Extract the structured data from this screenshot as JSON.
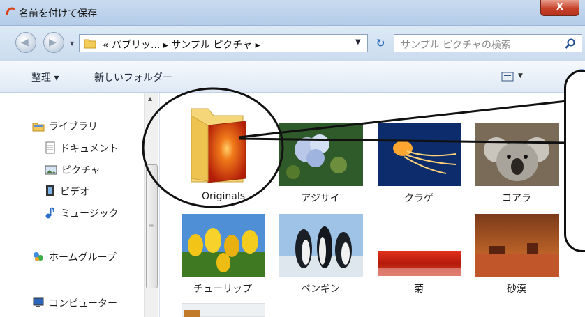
{
  "window": {
    "title": "名前を付けて保存",
    "close_label": "X"
  },
  "address_bar": {
    "path_text": "«  パブリッ...  ▸  サンプル ピクチャ  ▸",
    "search_placeholder": "サンプル ピクチャの検索"
  },
  "command_bar": {
    "organize": "整理 ▾",
    "new_folder": "新しいフォルダー"
  },
  "nav_pane": {
    "items": [
      {
        "label": "ライブラリ",
        "icon": "library-icon"
      },
      {
        "label": "ドキュメント",
        "icon": "documents-icon"
      },
      {
        "label": "ピクチャ",
        "icon": "pictures-icon"
      },
      {
        "label": "ビデオ",
        "icon": "video-icon"
      },
      {
        "label": "ミュージック",
        "icon": "music-icon"
      },
      {
        "label": "ホームグループ",
        "icon": "homegroup-icon"
      },
      {
        "label": "コンピューター",
        "icon": "computer-icon"
      }
    ]
  },
  "files": [
    {
      "name": "Originals",
      "type": "folder"
    },
    {
      "name": "アジサイ",
      "type": "image"
    },
    {
      "name": "クラゲ",
      "type": "image"
    },
    {
      "name": "コアラ",
      "type": "image"
    },
    {
      "name": "チューリップ",
      "type": "image"
    },
    {
      "name": "ペンギン",
      "type": "image"
    },
    {
      "name": "菊",
      "type": "image"
    },
    {
      "name": "砂漠",
      "type": "image"
    }
  ],
  "colors": {
    "titlebar": "#b4cce8",
    "close": "#c7412a",
    "selection_accent": "#2a6bbd"
  }
}
